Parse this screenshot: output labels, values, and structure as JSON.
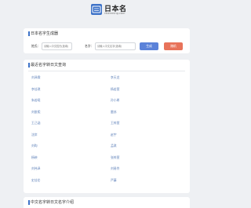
{
  "logo": {
    "title": "日本名",
    "subtitle": "ribenming.com"
  },
  "generator": {
    "heading": "日本名字生成器",
    "surname_label": "姓氏：",
    "surname_placeholder": "请输入中文姓氏(选填)",
    "name_label": "名字：",
    "name_placeholder": "请输入中文名字(选填)",
    "generate_label": "生成",
    "random_label": "随机"
  },
  "recent": {
    "heading": "最近名字转日文查询",
    "rows": [
      [
        "刘泽霖",
        "李天龙"
      ],
      [
        "李佳琪",
        "杨若萱"
      ],
      [
        "朱若曦",
        "孙小希"
      ],
      [
        "刘俊熙",
        "雷苏"
      ],
      [
        "王己涵",
        "王梓萱"
      ],
      [
        "沈岸",
        "赵宇"
      ],
      [
        "刘昀",
        "孟琪"
      ],
      [
        "杨映",
        "张梓萱"
      ],
      [
        "刘伟泽",
        "刘易伶"
      ],
      [
        "史佳伦",
        "严藤"
      ]
    ]
  },
  "intro": {
    "heading": "中文名字转日文名字介绍"
  }
}
